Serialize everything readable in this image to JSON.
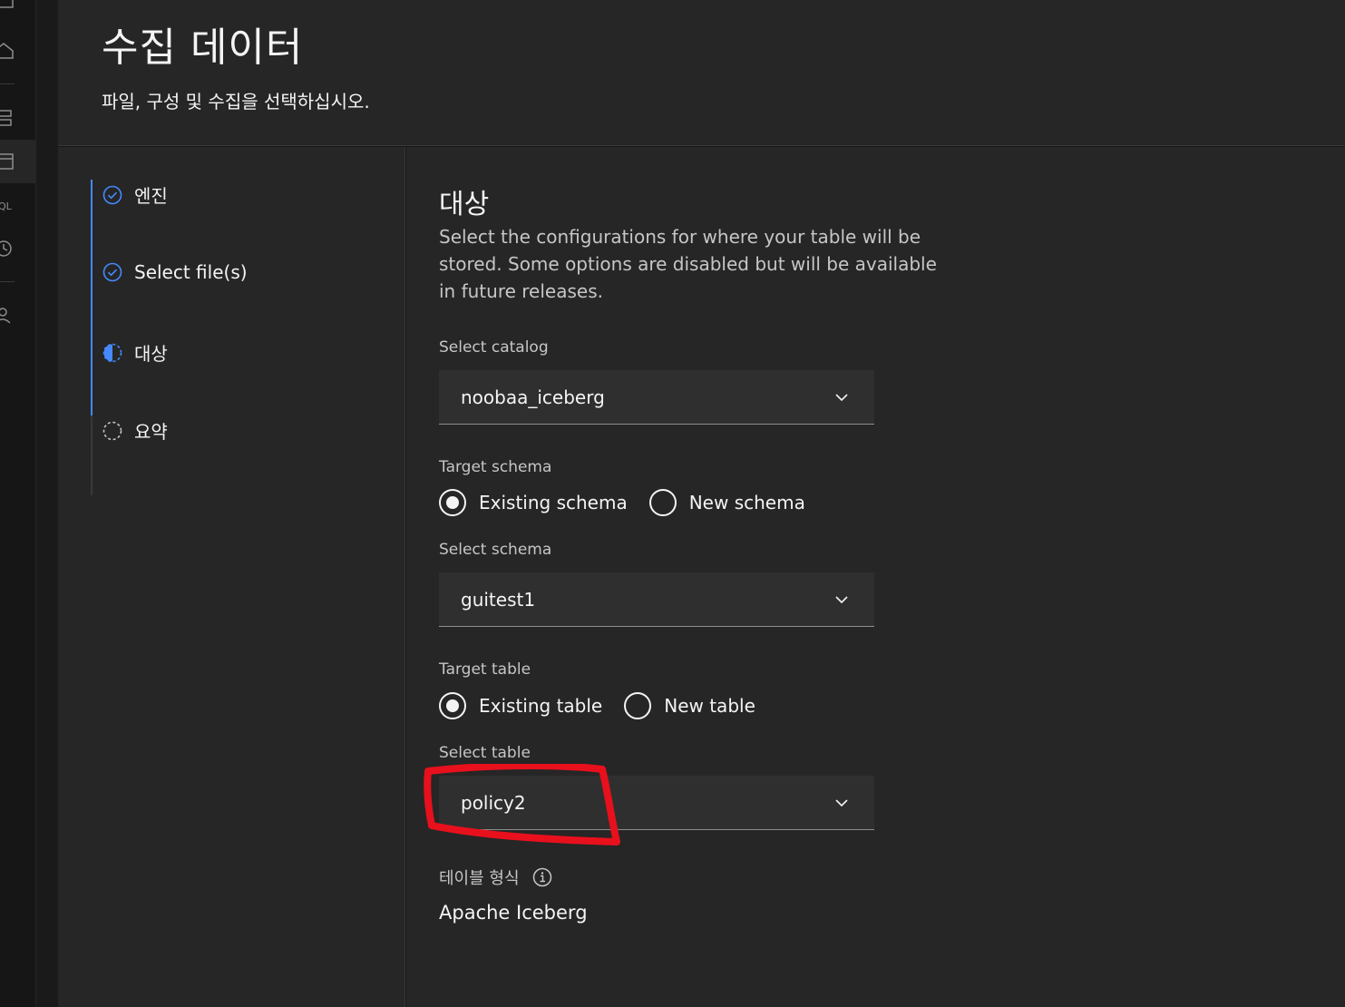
{
  "header": {
    "title": "수집 데이터",
    "subtitle": "파일, 구성 및 수집을 선택하십시오."
  },
  "steps": [
    {
      "label": "엔진",
      "state": "complete"
    },
    {
      "label": "Select file(s)",
      "state": "complete"
    },
    {
      "label": "대상",
      "state": "current"
    },
    {
      "label": "요약",
      "state": "incomplete"
    }
  ],
  "main": {
    "title": "대상",
    "description": "Select the configurations for where your table will be stored. Some options are disabled but will be available in future releases.",
    "catalog": {
      "label": "Select catalog",
      "value": "noobaa_iceberg"
    },
    "target_schema": {
      "label": "Target schema",
      "options": [
        {
          "label": "Existing schema",
          "selected": true
        },
        {
          "label": "New schema",
          "selected": false
        }
      ]
    },
    "schema": {
      "label": "Select schema",
      "value": "guitest1"
    },
    "target_table": {
      "label": "Target table",
      "options": [
        {
          "label": "Existing table",
          "selected": true
        },
        {
          "label": "New table",
          "selected": false
        }
      ]
    },
    "table": {
      "label": "Select table",
      "value": "policy2"
    },
    "table_format": {
      "label": "테이블 형식",
      "value": "Apache Iceberg"
    }
  },
  "colors": {
    "accent": "#4589ff",
    "annotation": "#e8101c",
    "panel": "#262626",
    "field": "#2f2f2f"
  }
}
